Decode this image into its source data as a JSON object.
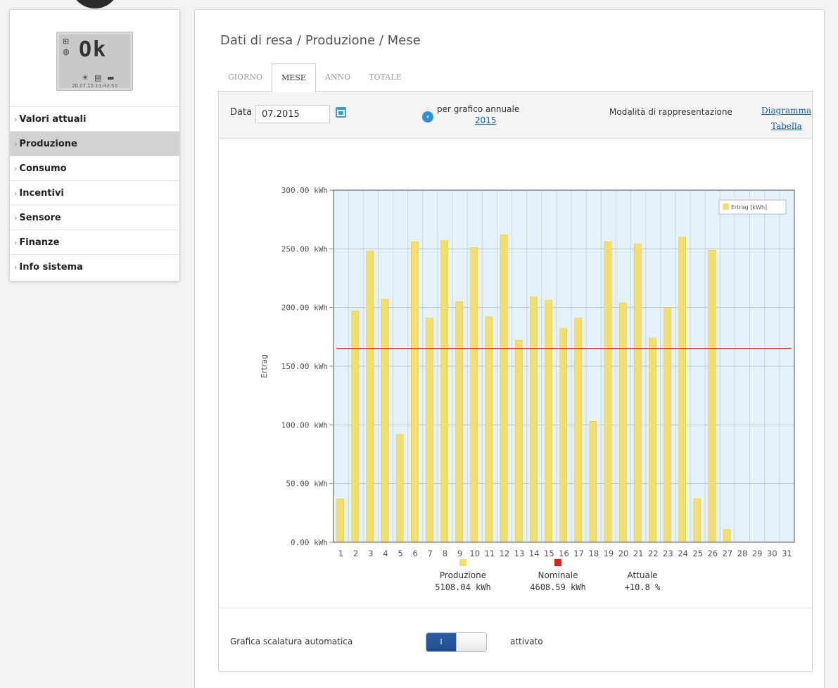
{
  "device": {
    "display_text": "Ok",
    "timestamp": "20.07.15 11:42:50"
  },
  "sidebar": {
    "items": [
      {
        "label": "Valori attuali",
        "active": false
      },
      {
        "label": "Produzione",
        "active": true
      },
      {
        "label": "Consumo",
        "active": false
      },
      {
        "label": "Incentivi",
        "active": false
      },
      {
        "label": "Sensore",
        "active": false
      },
      {
        "label": "Finanze",
        "active": false
      },
      {
        "label": "Info sistema",
        "active": false
      }
    ]
  },
  "main": {
    "title": "Dati di resa / Produzione / Mese",
    "tabs": [
      {
        "label": "GIORNO",
        "active": false
      },
      {
        "label": "MESE",
        "active": true
      },
      {
        "label": "ANNO",
        "active": false
      },
      {
        "label": "TOTALE",
        "active": false
      }
    ]
  },
  "filter": {
    "date_label": "Data",
    "date_value": "07.2015",
    "annual_label": "per grafico annuale",
    "annual_year": "2015",
    "mode_label": "Modalità di rappresentazione",
    "mode_diagram": "Diagramma",
    "mode_table": "Tabella"
  },
  "chart_data": {
    "type": "bar",
    "ylabel": "Ertrag",
    "ylim": [
      0,
      300
    ],
    "y_ticks": [
      "0.00 kWh",
      "50.00 kWh",
      "100.00 kWh",
      "150.00 kWh",
      "200.00 kWh",
      "250.00 kWh",
      "300.00 kWh"
    ],
    "categories": [
      "1",
      "2",
      "3",
      "4",
      "5",
      "6",
      "7",
      "8",
      "9",
      "10",
      "11",
      "12",
      "13",
      "14",
      "15",
      "16",
      "17",
      "18",
      "19",
      "20",
      "21",
      "22",
      "23",
      "24",
      "25",
      "26",
      "27",
      "28",
      "29",
      "30",
      "31"
    ],
    "series": [
      {
        "name": "Ertrag [kWh]",
        "color": "#f2e06a",
        "values": [
          37,
          197,
          248,
          207,
          92,
          256,
          191,
          257,
          205,
          251,
          192,
          262,
          172,
          209,
          206,
          182,
          191,
          103,
          256,
          204,
          254,
          174,
          200,
          260,
          37,
          249,
          11,
          0,
          0,
          0,
          0
        ]
      }
    ],
    "nominal_line": 165,
    "nominal_color": "#d9221c",
    "legend_position": "top-right",
    "grid": true,
    "summary": [
      {
        "label": "Produzione",
        "value": "5108.04 kWh",
        "color": "#f2e06a"
      },
      {
        "label": "Nominale",
        "value": "4608.59 kWh",
        "color": "#d9221c"
      },
      {
        "label": "Attuale",
        "value": "+10.8 %",
        "color": ""
      }
    ]
  },
  "footer": {
    "autoscale_label": "Grafica scalatura automatica",
    "toggle_on_text": "I",
    "toggle_state": "attivato"
  },
  "colors": {
    "accent": "#1a5ea8",
    "toggle_on": "#1e4a8a",
    "plot_bg": "#e6f2fb",
    "sidebar_active": "#d2d2d2"
  }
}
